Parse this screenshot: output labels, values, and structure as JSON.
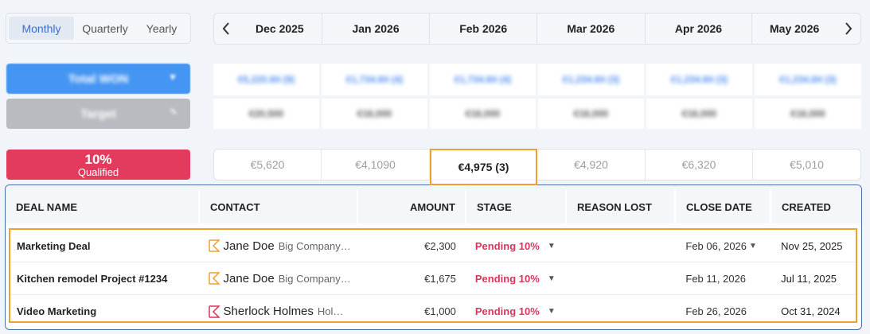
{
  "period_toggle": {
    "options": [
      "Monthly",
      "Quarterly",
      "Yearly"
    ],
    "selected": "Monthly"
  },
  "months": [
    "Dec 2025",
    "Jan 2026",
    "Feb 2026",
    "Mar 2026",
    "Apr 2026",
    "May 2026"
  ],
  "icons": {
    "prev": "chevron-left-icon",
    "next": "chevron-right-icon",
    "stage_caret": "caret-down-icon",
    "date_caret": "caret-down-icon",
    "contact_flag": "flag-icon"
  },
  "side": {
    "won_label": "Total WON",
    "target_label": "Target",
    "qualified_pct": "10%",
    "qualified_label": "Qualified"
  },
  "won_values": [
    "€5,220.84 (9)",
    "€1,734.84 (4)",
    "€1,734.84 (4)",
    "€1,234.84 (3)",
    "€1,234.84 (3)",
    "€1,234.84 (3)"
  ],
  "target_values": [
    "€20,500",
    "€16,000",
    "€16,000",
    "€16,000",
    "€16,000",
    "€16,000"
  ],
  "qualified_values": [
    "€5,620",
    "€4,1090",
    "€4,975 (3)",
    "€4,920",
    "€6,320",
    "€5,010"
  ],
  "table": {
    "headers": {
      "deal": "DEAL NAME",
      "contact": "CONTACT",
      "amount": "AMOUNT",
      "stage": "STAGE",
      "reason": "REASON LOST",
      "close": "CLOSE DATE",
      "created": "CREATED"
    },
    "rows": [
      {
        "deal": "Marketing Deal",
        "contact_name": "Jane Doe",
        "contact_company": "Big Company…",
        "amount": "€2,300",
        "stage": "Pending 10%",
        "reason": "",
        "close": "Feb 06, 2026",
        "created": "Nov 25, 2025",
        "flag_color": "#f0a030"
      },
      {
        "deal": "Kitchen remodel Project #1234",
        "contact_name": "Jane Doe",
        "contact_company": "Big Company…",
        "amount": "€1,675",
        "stage": "Pending 10%",
        "reason": "",
        "close": "Feb 11, 2026",
        "created": "Jul 11, 2025",
        "flag_color": "#f0a030"
      },
      {
        "deal": "Video Marketing",
        "contact_name": "Sherlock Holmes",
        "contact_company": "Hol…",
        "amount": "€1,000",
        "stage": "Pending 10%",
        "reason": "",
        "close": "Feb 26, 2026",
        "created": "Oct 31, 2024",
        "flag_color": "#d8365b"
      }
    ]
  },
  "colors": {
    "accent_blue": "#4596f2",
    "qualified_red": "#e23b5e",
    "stage_red": "#d8365b",
    "highlight_orange": "#f0a030"
  }
}
